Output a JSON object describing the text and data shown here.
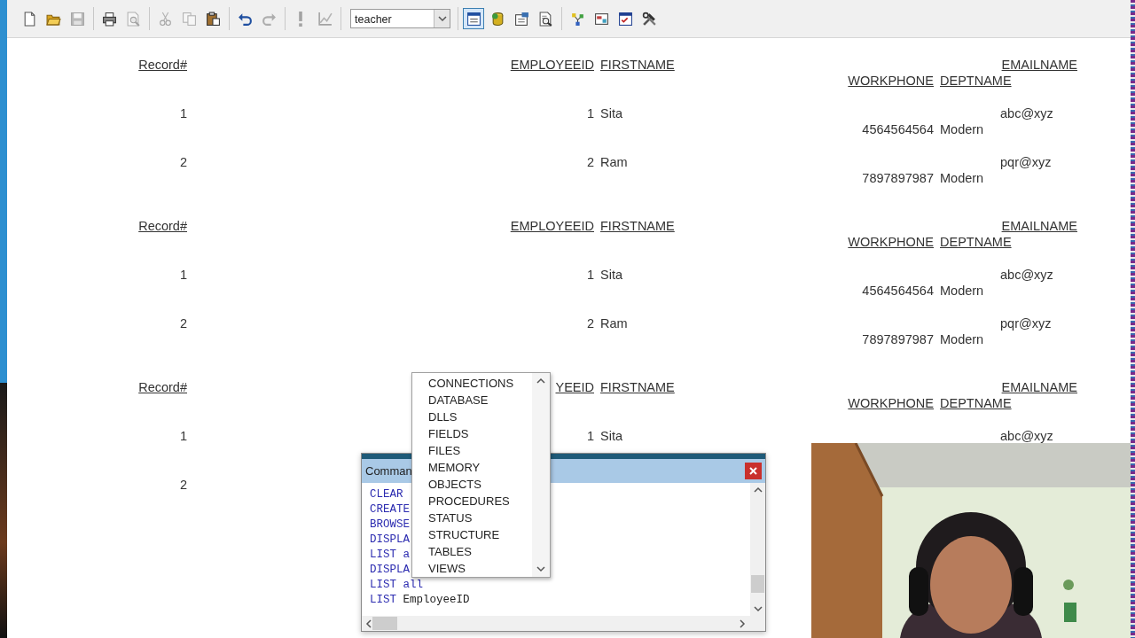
{
  "toolbar": {
    "groups_before": [
      [
        {
          "disabled": false
        },
        {
          "disabled": false
        },
        {
          "disabled": true
        }
      ],
      [
        {
          "disabled": false
        },
        {
          "disabled": true
        }
      ],
      [
        {
          "disabled": true
        },
        {
          "disabled": true
        },
        {
          "disabled": false
        }
      ],
      [
        {
          "disabled": false
        },
        {
          "disabled": true
        }
      ],
      [
        {
          "disabled": true
        },
        {
          "disabled": true
        }
      ]
    ],
    "combo": {
      "value": "teacher"
    },
    "groups_after": [
      [
        {
          "selected": true
        },
        {
          "selected": false
        },
        {
          "selected": false
        },
        {
          "selected": false
        }
      ],
      [
        {
          "selected": false
        },
        {
          "selected": false
        },
        {
          "selected": false
        },
        {
          "selected": false
        }
      ]
    ]
  },
  "report": {
    "blocks": [
      {
        "header": {
          "record": "Record#",
          "employeeid": "EMPLOYEEID",
          "firstname": "FIRSTNAME",
          "emailname": "EMAILNAME",
          "workphone": "WORKPHONE",
          "deptname": "DEPTNAME"
        },
        "rows": [
          {
            "record": "1",
            "employeeid": "1",
            "firstname": "Sita",
            "emailname": "abc@xyz",
            "workphone": "4564564564",
            "deptname": "Modern"
          },
          {
            "record": "2",
            "employeeid": "2",
            "firstname": "Ram",
            "emailname": "pqr@xyz",
            "workphone": "7897897987",
            "deptname": "Modern"
          }
        ]
      },
      {
        "header": {
          "record": "Record#",
          "employeeid": "EMPLOYEEID",
          "firstname": "FIRSTNAME",
          "emailname": "EMAILNAME",
          "workphone": "WORKPHONE",
          "deptname": "DEPTNAME"
        },
        "rows": [
          {
            "record": "1",
            "employeeid": "1",
            "firstname": "Sita",
            "emailname": "abc@xyz",
            "workphone": "4564564564",
            "deptname": "Modern"
          },
          {
            "record": "2",
            "employeeid": "2",
            "firstname": "Ram",
            "emailname": "pqr@xyz",
            "workphone": "7897897987",
            "deptname": "Modern"
          }
        ]
      },
      {
        "header": {
          "record": "Record#",
          "employeeid": "YEEID",
          "firstname": "FIRSTNAME",
          "emailname": "EMAILNAME",
          "workphone": "WORKPHONE",
          "deptname": "DEPTNAME"
        },
        "rows": [
          {
            "record": "1",
            "employeeid": "1",
            "firstname": "Sita",
            "emailname": "abc@xyz"
          },
          {
            "record": "2"
          }
        ]
      }
    ]
  },
  "command_window": {
    "title": "Comman",
    "lines": [
      {
        "parts": [
          {
            "text": "CLEAR",
            "kind": "keyword"
          }
        ]
      },
      {
        "parts": [
          {
            "text": "CREATE",
            "kind": "keyword"
          }
        ]
      },
      {
        "parts": [
          {
            "text": "BROWSE",
            "kind": "keyword"
          }
        ]
      },
      {
        "parts": [
          {
            "text": "DISPLA",
            "kind": "keyword"
          }
        ]
      },
      {
        "parts": [
          {
            "text": "LIST a",
            "kind": "keyword"
          }
        ]
      },
      {
        "parts": [
          {
            "text": "DISPLA",
            "kind": "keyword"
          }
        ]
      },
      {
        "parts": [
          {
            "text": "LIST all",
            "kind": "keyword"
          }
        ]
      },
      {
        "parts": [
          {
            "text": "LIST",
            "kind": "keyword"
          },
          {
            "text": " EmployeeID",
            "kind": "plain"
          }
        ]
      }
    ]
  },
  "popup": {
    "items": [
      "CONNECTIONS",
      "DATABASE",
      "DLLS",
      "FIELDS",
      "FILES",
      "MEMORY",
      "OBJECTS",
      "PROCEDURES",
      "STATUS",
      "STRUCTURE",
      "TABLES",
      "VIEWS"
    ]
  }
}
